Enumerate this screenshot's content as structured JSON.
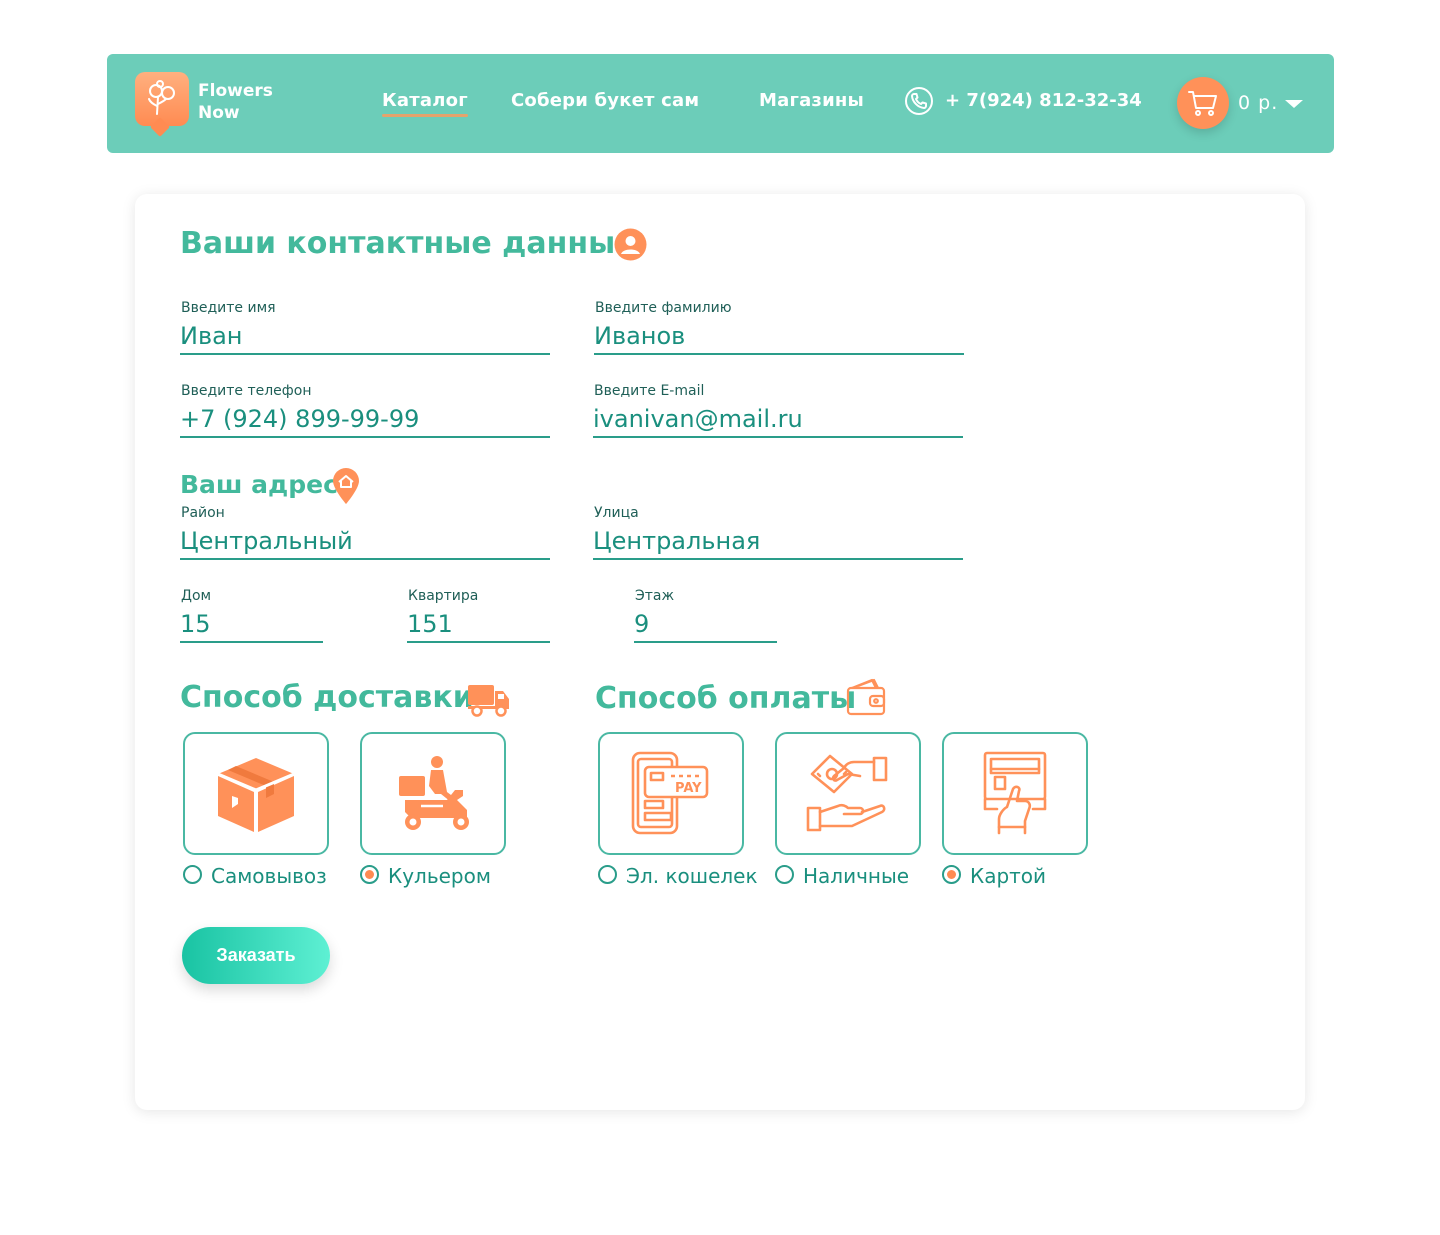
{
  "header": {
    "brand_line1": "Flowers",
    "brand_line2": "Now",
    "nav": {
      "catalog": "Каталог",
      "build": "Собери букет сам",
      "shops": "Магазины"
    },
    "phone": "+ 7(924) 812-32-34",
    "cart_sum": "0 р."
  },
  "contacts": {
    "title": "Ваши контактные данные",
    "first_name": {
      "label": "Введите имя",
      "value": "Иван"
    },
    "last_name": {
      "label": "Введите фамилию",
      "value": "Иванов"
    },
    "phone": {
      "label": "Введите телефон",
      "value": "+7 (924) 899-99-99"
    },
    "email": {
      "label": "Введите E-mail",
      "value": "ivanivan@mail.ru"
    }
  },
  "address": {
    "title": "Ваш адрес",
    "district": {
      "label": "Район",
      "value": "Центральный"
    },
    "street": {
      "label": "Улица",
      "value": "Центральная"
    },
    "house": {
      "label": "Дом",
      "value": "15"
    },
    "apartment": {
      "label": "Квартира",
      "value": "151"
    },
    "floor": {
      "label": "Этаж",
      "value": "9"
    }
  },
  "delivery": {
    "title": "Способ доставки",
    "options": [
      {
        "label": "Самовывоз",
        "selected": false,
        "icon": "box-icon"
      },
      {
        "label": "Кульером",
        "selected": true,
        "icon": "courier-scooter-icon"
      }
    ]
  },
  "payment": {
    "title": "Способ оплаты",
    "options": [
      {
        "label": "Эл. кошелек",
        "selected": false,
        "icon": "mobile-pay-icon"
      },
      {
        "label": "Наличные",
        "selected": false,
        "icon": "cash-hands-icon"
      },
      {
        "label": "Картой",
        "selected": true,
        "icon": "card-terminal-icon"
      }
    ]
  },
  "order_button": "Заказать",
  "colors": {
    "accent": "#6ccdb9",
    "orange": "#ff8b52",
    "heading": "#43b99c",
    "text": "#1a8f7e"
  }
}
